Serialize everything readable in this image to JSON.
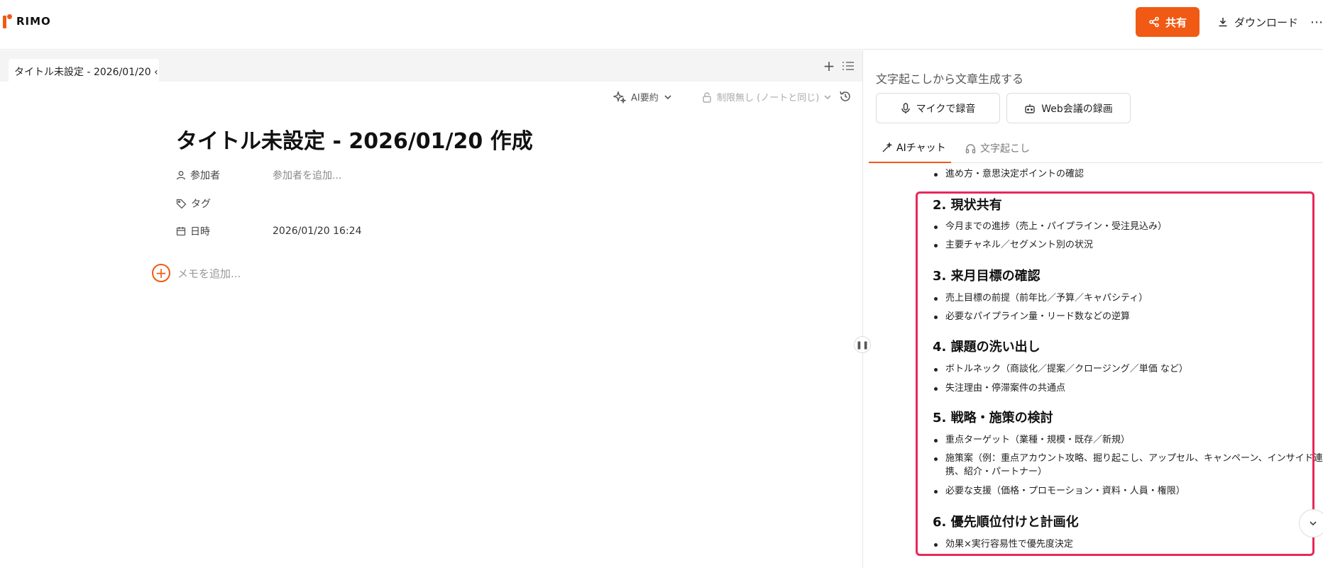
{
  "app": {
    "logo_text": "RIMO",
    "brand_color": "#f05a14",
    "highlight_color": "#e8285a"
  },
  "header": {
    "share_label": "共有",
    "download_label": "ダウンロード",
    "more_label": "⋯"
  },
  "editor": {
    "tab_label": "タイトル未設定 - 2026/01/20 ‹",
    "ai_summary_label": "AI要約",
    "restriction_label": "制限無し (ノートと同じ)",
    "title": "タイトル未設定 - 2026/01/20 作成",
    "participants_label": "参加者",
    "participants_placeholder": "参加者を追加...",
    "tags_label": "タグ",
    "date_label": "日時",
    "date_value": "2026/01/20 16:24",
    "add_memo_label": "メモを追加..."
  },
  "right_panel": {
    "heading": "文字起こしから文章生成する",
    "mic_button": "マイクで録音",
    "web_button": "Web会議の録画",
    "tabs": [
      {
        "label": "AIチャット",
        "active": true
      },
      {
        "label": "文字起こし",
        "active": false
      }
    ],
    "chat": {
      "top_bullet": "進め方・意思決定ポイントの確認",
      "sections": [
        {
          "heading": "2. 現状共有",
          "items": [
            "今月までの進捗（売上・パイプライン・受注見込み）",
            "主要チャネル／セグメント別の状況"
          ]
        },
        {
          "heading": "3. 来月目標の確認",
          "items": [
            "売上目標の前提（前年比／予算／キャパシティ）",
            "必要なパイプライン量・リード数などの逆算"
          ]
        },
        {
          "heading": "4. 課題の洗い出し",
          "items": [
            "ボトルネック（商談化／提案／クロージング／単価 など）",
            "失注理由・停滞案件の共通点"
          ]
        },
        {
          "heading": "5. 戦略・施策の検討",
          "items": [
            "重点ターゲット（業種・規模・既存／新規）",
            "施策案（例：重点アカウント攻略、掘り起こし、アップセル、キャンペーン、インサイド連",
            "携、紹介・パートナー）",
            "必要な支援（価格・プロモーション・資料・人員・権限）"
          ]
        },
        {
          "heading": "6. 優先順位付けと計画化",
          "items": [
            "効果×実行容易性で優先度決定"
          ]
        }
      ]
    }
  }
}
